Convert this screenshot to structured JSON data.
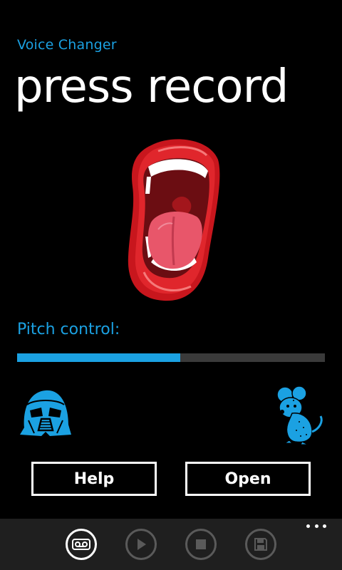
{
  "header": {
    "app_title": "Voice Changer",
    "page_title": "press record"
  },
  "pitch": {
    "label": "Pitch control:",
    "value_fraction": 0.53
  },
  "buttons": {
    "help_label": "Help",
    "open_label": "Open"
  },
  "appbar": {
    "items": [
      {
        "icon": "voicemail-icon",
        "enabled": true
      },
      {
        "icon": "play-icon",
        "enabled": false
      },
      {
        "icon": "stop-icon",
        "enabled": false
      },
      {
        "icon": "save-icon",
        "enabled": false
      }
    ],
    "more_icon": "ellipsis-icon"
  },
  "colors": {
    "accent": "#1ba1e2",
    "background": "#000000",
    "appbar": "#1f1f1f",
    "slider_track": "#3a3a3a",
    "disabled": "#5a5a5a"
  }
}
